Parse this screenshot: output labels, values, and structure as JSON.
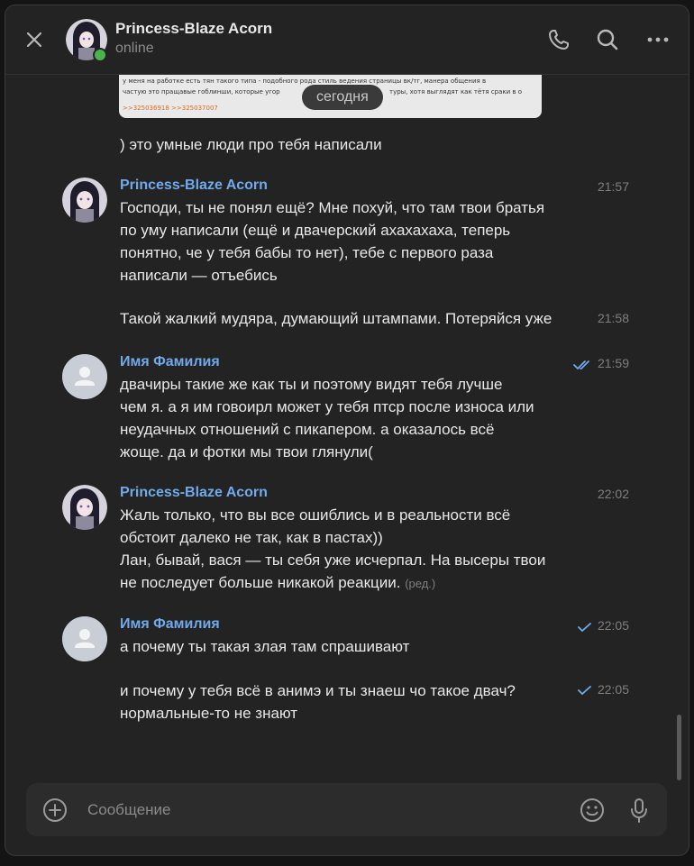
{
  "header": {
    "name": "Princess-Blaze Acorn",
    "status": "online"
  },
  "preview": {
    "line1": "у меня на работке есть тян такого типа - подобного рода стиль ведения страницы вк/тг, манера общения в",
    "line2": "частую это пращавые гоблинши, которые угор",
    "line2b": "туры, хотя выглядят как тётя сраки в о",
    "links": ">>325036918 >>325037007"
  },
  "date_pill": "сегодня",
  "top_text": ") это умные люди про тебя написали",
  "messages": [
    {
      "author": "Princess-Blaze Acorn",
      "time": "21:57",
      "lines": [
        "Господи, ты не понял ещё? Мне похуй, что там твои братья",
        "по уму написали (ещё и двачерский ахахахаха, теперь",
        "понятно, че у тебя бабы то нет), тебе с первого раза",
        "написали — отъебись"
      ]
    },
    {
      "time": "21:58",
      "lines": [
        "Такой жалкий мудяра, думающий штампами. Потеряйся уже"
      ]
    },
    {
      "author": "Имя Фамилия",
      "time": "21:59",
      "lines": [
        "двачиры такие же как ты и поэтому видят тебя лучше",
        "чем я. а я им говоирл может у тебя птср после износа или",
        "неудачных отношений с пикапером. а оказалось всё",
        "жоще. да и фотки мы твои глянули("
      ]
    },
    {
      "author": "Princess-Blaze Acorn",
      "time": "22:02",
      "lines": [
        "Жаль только, что вы все ошиблись и в реальности всё",
        "обстоит далеко не так, как в пастах))",
        "Лан, бывай, вася — ты себя уже исчерпал. На высеры твои",
        "не последует больше никакой реакции."
      ],
      "edited": "(ред.)"
    },
    {
      "author": "Имя Фамилия",
      "time": "22:05",
      "lines": [
        "а почему ты такая злая там спрашивают"
      ]
    },
    {
      "time": "22:05",
      "lines": [
        "и почему у тебя всё в анимэ и ты знаеш чо такое двач?",
        "нормальные-то не знают"
      ]
    }
  ],
  "composer": {
    "placeholder": "Сообщение"
  },
  "icons": {
    "close": "close-icon",
    "call": "phone-icon",
    "search": "search-icon",
    "more": "more-icon",
    "attach": "plus-circle-icon",
    "emoji": "emoji-icon",
    "mic": "microphone-icon",
    "read": "double-check-icon",
    "sent": "check-icon"
  },
  "colors": {
    "background": "#232323",
    "accent_name": "#71aaeb",
    "online": "#4bb34b",
    "read_check": "#71aaeb"
  }
}
